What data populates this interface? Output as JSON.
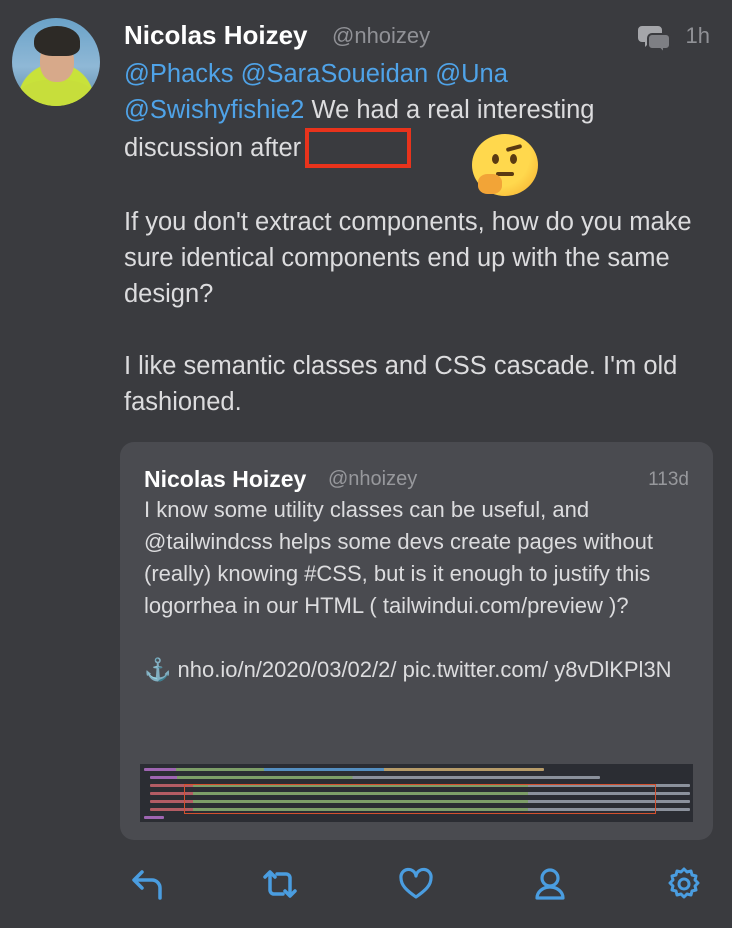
{
  "tweet": {
    "author_name": "Nicolas Hoizey",
    "author_handle": "@nhoizey",
    "time": "1h",
    "mentions": [
      "@Phacks",
      "@SaraSoueidan",
      "@Una",
      "@Swishyfishie2"
    ],
    "text_line1_rest": " We had a real interesting",
    "text_line2": "discussion after",
    "para2": "If you don't extract components, how do you make sure identical components end up with the same design?",
    "para3": "I like semantic classes and CSS cascade. I'm old fashioned."
  },
  "quoted": {
    "author_name": "Nicolas Hoizey",
    "author_handle": "@nhoizey",
    "time": "113d",
    "para1": "I know some utility classes can be useful, and @tailwindcss helps some devs create pages without (really) knowing #CSS, but is it enough to justify this logorrhea in our HTML ( tailwindui.com/preview )?",
    "anchor_glyph": "⚓",
    "links": " nho.io/n/2020/03/02/2/ pic.twitter.com/ y8vDlKPl3N"
  },
  "icons": {
    "conversation": "conversation-icon",
    "reply": "reply-icon",
    "retweet": "retweet-icon",
    "like": "heart-icon",
    "profile": "person-icon",
    "settings": "gear-icon"
  },
  "colors": {
    "background": "#3a3b3f",
    "card": "#4a4b50",
    "mention": "#4fa3e8",
    "action": "#4a9de0",
    "redaction_box": "#e8331c"
  }
}
